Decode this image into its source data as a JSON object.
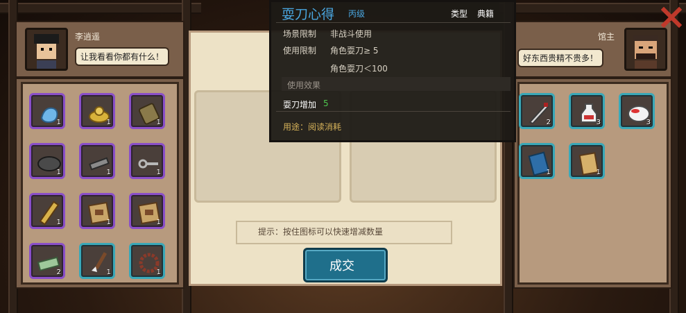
{
  "left_merchant": {
    "name": "李逍遥",
    "speech": "让我看看你都有什么！"
  },
  "right_merchant": {
    "name": "馆主",
    "speech": "好东西贵精不贵多！"
  },
  "left_items": [
    {
      "icon": "blue-gloves-icon",
      "count": "1"
    },
    {
      "icon": "gold-ingot-icon",
      "count": "1"
    },
    {
      "icon": "leather-armor-icon",
      "count": "1"
    },
    {
      "icon": "iron-wok-icon",
      "count": "1"
    },
    {
      "icon": "whetstone-icon",
      "count": "1"
    },
    {
      "icon": "iron-key-icon",
      "count": "1"
    },
    {
      "icon": "bamboo-scroll-icon",
      "count": "1"
    },
    {
      "icon": "map-parchment-icon",
      "count": "1"
    },
    {
      "icon": "map-parchment-icon",
      "count": "1"
    },
    {
      "icon": "paper-money-icon",
      "count": "2"
    },
    {
      "icon": "writing-brush-icon",
      "count": "1"
    },
    {
      "icon": "prayer-beads-icon",
      "count": "1"
    }
  ],
  "right_items": [
    {
      "icon": "dagger-icon",
      "count": "2"
    },
    {
      "icon": "medicine-bottle-icon",
      "count": "3"
    },
    {
      "icon": "rice-bowl-icon",
      "count": "3"
    },
    {
      "icon": "blue-book-icon",
      "count": "1"
    },
    {
      "icon": "scroll-book-icon",
      "count": "1"
    }
  ],
  "tooltip": {
    "title": "耍刀心得",
    "grade": "丙级",
    "type_label": "类型",
    "type_value": "典籍",
    "scene_label": "场景限制",
    "scene_value": "非战斗使用",
    "use_label": "使用限制",
    "use_value_1": "角色耍刀≥ 5",
    "use_value_2": "角色耍刀＜100",
    "effect_header": "使用效果",
    "effect_text": "耍刀增加",
    "effect_value": "5",
    "purpose": "用途：阅读消耗"
  },
  "trade": {
    "hint": "提示：按住图标可以快速增减数量",
    "button_label": "成交"
  },
  "colors": {
    "purple_frame": "#8a4fc8",
    "cyan_frame": "#3aa8b8",
    "title_blue": "#4aa6e0",
    "effect_green": "#4fc84f",
    "close_red": "#c0392b"
  }
}
